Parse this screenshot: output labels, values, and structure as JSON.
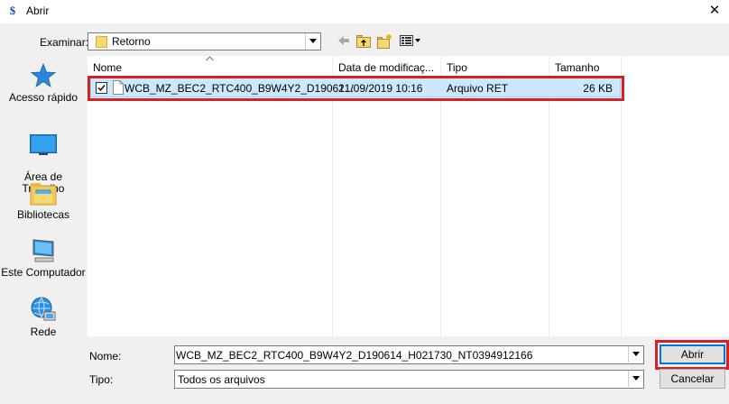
{
  "window": {
    "title": "Abrir",
    "app_icon_glyph": "$"
  },
  "toolbar": {
    "lookin_label": "Examinar:",
    "lookin_value": "Retorno"
  },
  "places": [
    {
      "label": "Acesso rápido",
      "icon": "star-icon"
    },
    {
      "label": "Área de\nTrabalho",
      "icon": "desktop-icon"
    },
    {
      "label": "Bibliotecas",
      "icon": "libraries-icon"
    },
    {
      "label": "Este Computador",
      "icon": "computer-icon"
    },
    {
      "label": "Rede",
      "icon": "network-icon"
    }
  ],
  "filelist": {
    "columns": [
      "Nome",
      "Data de modificaç...",
      "Tipo",
      "Tamanho"
    ],
    "rows": [
      {
        "name": "WCB_MZ_BEC2_RTC400_B9W4Y2_D19061...",
        "date": "21/09/2019 10:16",
        "type": "Arquivo RET",
        "size": "26 KB",
        "checked": true,
        "selected": true
      }
    ]
  },
  "form": {
    "name_label": "Nome:",
    "name_value": "WCB_MZ_BEC2_RTC400_B9W4Y2_D190614_H021730_NT0394912166",
    "type_label": "Tipo:",
    "type_value": "Todos os arquivos"
  },
  "buttons": {
    "open": "Abrir",
    "cancel": "Cancelar"
  },
  "colors": {
    "selection": "#cce8ff",
    "highlight_outline": "#d81f26",
    "default_button_border": "#0078d7"
  }
}
